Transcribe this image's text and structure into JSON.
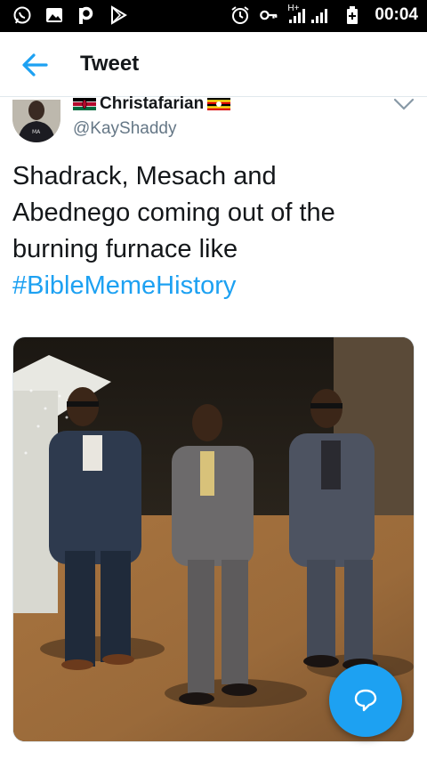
{
  "status_bar": {
    "time": "00:04",
    "network_label": "H+",
    "left_icons": [
      "whatsapp-icon",
      "gallery-icon",
      "pocket-p-icon",
      "play-store-icon"
    ],
    "right_icons": [
      "alarm-icon",
      "vpn-key-icon",
      "signal-icon",
      "battery-icon"
    ]
  },
  "app_bar": {
    "title": "Tweet",
    "back_icon": "arrow-left-icon"
  },
  "tweet": {
    "author": {
      "display_name": "Christafarian",
      "handle": "@KayShaddy",
      "flags": [
        "kenya-flag-emoji",
        "uganda-flag-emoji"
      ]
    },
    "text_line_1": "Shadrack, Mesach and",
    "text_line_2": "Abednego coming out of the",
    "text_line_3": "burning furnace like",
    "hashtag": "#BibleMemeHistory",
    "menu_icon": "chevron-down-icon"
  },
  "fab": {
    "icon": "reply-bubble-icon"
  },
  "colors": {
    "accent": "#1da1f2",
    "text_primary": "#14171a",
    "text_secondary": "#657786",
    "status_bar_bg": "#000000"
  }
}
